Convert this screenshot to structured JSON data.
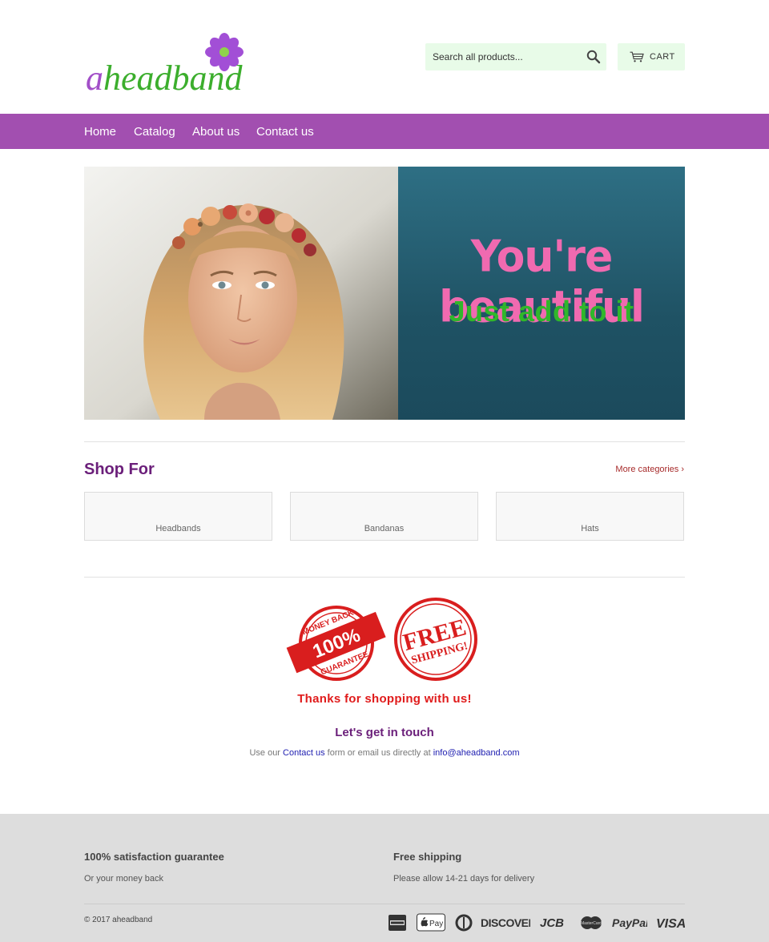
{
  "header": {
    "logo_text_first": "a",
    "logo_text_rest": "headband",
    "search_placeholder": "Search all products...",
    "cart_label": "CART"
  },
  "nav": {
    "items": [
      "Home",
      "Catalog",
      "About us",
      "Contact us"
    ]
  },
  "hero": {
    "headline": "You're beautiful",
    "subline": "Just add to it"
  },
  "shop": {
    "title": "Shop For",
    "more_label": "More categories ›",
    "categories": [
      "Headbands",
      "Bandanas",
      "Hats"
    ]
  },
  "badges": {
    "money_back_top": "MONEY BACK",
    "money_back_pct": "100%",
    "money_back_bottom": "GUARANTEE",
    "free_line1": "FREE",
    "free_line2": "SHIPPING!"
  },
  "thanks": "Thanks for shopping with us!",
  "contact": {
    "title": "Let's get in touch",
    "text_before": "Use our ",
    "link_label": "Contact us",
    "text_middle": " form or email us directly at ",
    "email": "info@aheadband.com"
  },
  "footer": {
    "col1_title": "100% satisfaction guarantee",
    "col1_text": "Or your money back",
    "col2_title": "Free shipping",
    "col2_text": "Please allow 14-21 days for delivery",
    "copyright": "© 2017 aheadband",
    "payments": [
      "american-express-icon",
      "apple-pay-icon",
      "diners-club-icon",
      "discover-icon",
      "jcb-icon",
      "master-icon",
      "paypal-icon",
      "visa-icon"
    ],
    "payment_labels": {
      "apple_pay": "Pay",
      "discover": "DISCOVER",
      "jcb": "JCB",
      "master": "MasterCard",
      "paypal": "PayPal",
      "visa": "VISA"
    }
  },
  "colors": {
    "nav_bg": "#a24fb0",
    "accent_purple": "#6b1f7a",
    "logo_green": "#3cae2d",
    "search_bg": "#e8fbe8",
    "hero_pink": "#f06ab0",
    "hero_green": "#30b72a",
    "stamp_red": "#e01b1b"
  }
}
